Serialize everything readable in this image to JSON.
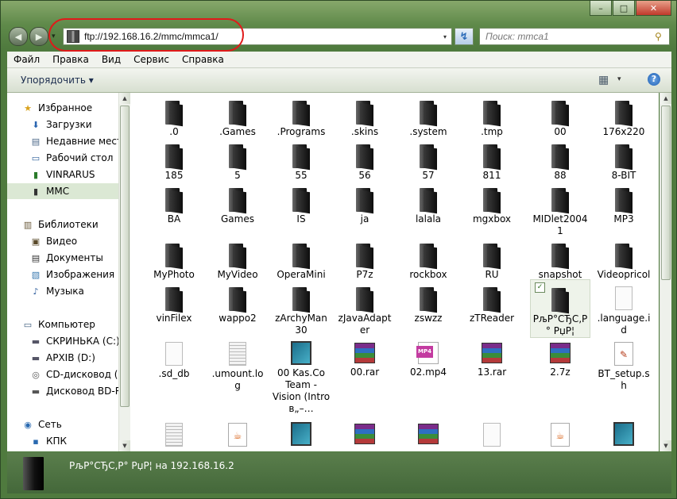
{
  "window": {
    "minimize_glyph": "–",
    "maximize_glyph": "□",
    "close_glyph": "✕"
  },
  "nav": {
    "back_glyph": "◀",
    "forward_glyph": "▶",
    "recent_glyph": "▾"
  },
  "address": {
    "value": "ftp://192.168.16.2/mmc/mmca1/",
    "dropdown_glyph": "▾",
    "refresh_glyph": "↯"
  },
  "search": {
    "placeholder": "Поиск: mmca1",
    "icon_glyph": "⚲"
  },
  "menu": {
    "items": [
      "Файл",
      "Правка",
      "Вид",
      "Сервис",
      "Справка"
    ]
  },
  "toolbar": {
    "organize": "Упорядочить ▾",
    "views_glyph": "▦",
    "views_dropdown": "▾",
    "help_glyph": "?"
  },
  "sidebar": {
    "favorites": [
      "Избранное",
      "Загрузки",
      "Недавние места",
      "Рабочий стол",
      "VINRARUS",
      "MMC"
    ],
    "libraries": [
      "Библиотеки",
      "Видео",
      "Документы",
      "Изображения",
      "Музыка"
    ],
    "computer": [
      "Компьютер",
      "СКРИНЬКА (C:)",
      "АРХІВ (D:)",
      "CD-дисковод (F:)",
      "Дисковод BD-RO"
    ],
    "network": [
      "Сеть",
      "КПК"
    ],
    "icons": {
      "star": "★",
      "downloads": "⬇",
      "recent": "▤",
      "desktop": "▭",
      "folder": "▮",
      "library": "▥",
      "video": "▣",
      "documents": "▤",
      "pictures": "▧",
      "music": "♪",
      "computer": "▭",
      "drive": "▬",
      "cd": "◎",
      "network": "◉",
      "device": "▪"
    }
  },
  "files": {
    "rows": [
      [
        ".0",
        ".Games",
        ".Programs",
        ".skins",
        ".system",
        ".tmp",
        "00",
        "176x220"
      ],
      [
        "185",
        "5",
        "55",
        "56",
        "57",
        "811",
        "88",
        "8-BIT"
      ],
      [
        "BA",
        "Games",
        "IS",
        "ja",
        "lalala",
        "mgxbox",
        "MIDlet2004 1",
        "MP3"
      ],
      [
        "MyPhoto",
        "MyVideo",
        "OperaMini",
        "P7z",
        "rockbox",
        "RU",
        "snapshot",
        "Videopricol"
      ],
      [
        "vinFilex",
        "wappo2",
        "zArchyMan 30",
        "zJavaAdapt er",
        "zswzz",
        "zTReader",
        "РљР°СЂС‚Р° РџР¦",
        ".language.i d"
      ],
      [
        ".sd_db",
        ".umount.lo g",
        "00 Kas.Co Team - Vision (Intro в„–…",
        "00.rar",
        "02.mp4",
        "13.rar",
        "2.7z",
        "BT_setup.s h"
      ]
    ],
    "selected_check": "✓",
    "mp4_tag": "MP4",
    "java_glyph": "☕",
    "setup_glyph": "✎"
  },
  "details": {
    "text": "РљР°СЂС‚Р° РџР¦ на 192.168.16.2"
  },
  "scroll": {
    "up": "▲",
    "down": "▼",
    "left": "◀",
    "right": "▶"
  }
}
